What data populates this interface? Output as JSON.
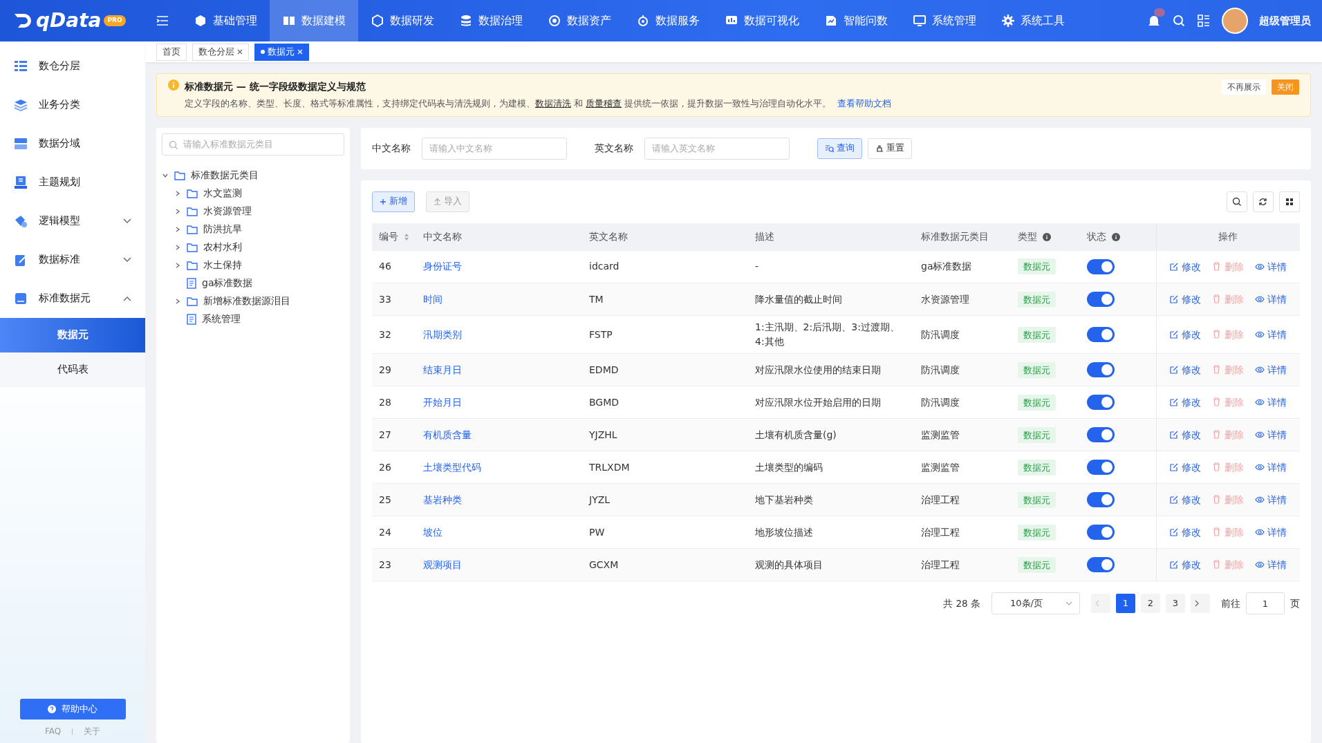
{
  "topbar": {
    "logo": "qData",
    "logo_badge": "PRO",
    "nav": [
      {
        "label": "基础管理",
        "selected": false
      },
      {
        "label": "数据建模",
        "selected": true
      },
      {
        "label": "数据研发",
        "selected": false
      },
      {
        "label": "数据治理",
        "selected": false
      },
      {
        "label": "数据资产",
        "selected": false
      },
      {
        "label": "数据服务",
        "selected": false
      },
      {
        "label": "数据可视化",
        "selected": false
      },
      {
        "label": "智能问数",
        "selected": false
      },
      {
        "label": "系统管理",
        "selected": false
      },
      {
        "label": "系统工具",
        "selected": false
      }
    ],
    "user": "超级管理员"
  },
  "sidebar": {
    "items": [
      {
        "label": "数仓分层"
      },
      {
        "label": "业务分类"
      },
      {
        "label": "数据分域"
      },
      {
        "label": "主题规划"
      },
      {
        "label": "逻辑模型",
        "expanded": false
      },
      {
        "label": "数据标准",
        "expanded": false
      },
      {
        "label": "标准数据元",
        "expanded": true,
        "children": [
          {
            "label": "数据元",
            "selected": true
          },
          {
            "label": "代码表",
            "selected": false
          }
        ]
      }
    ],
    "help_button": "帮助中心",
    "footer_links": [
      "FAQ",
      "关于"
    ]
  },
  "tabs": [
    {
      "label": "首页",
      "selected": false,
      "closable": false
    },
    {
      "label": "数仓分层",
      "selected": false,
      "closable": true
    },
    {
      "label": "数据元",
      "selected": true,
      "closable": true
    }
  ],
  "notice": {
    "title": "标准数据元 — 统一字段级数据定义与规范",
    "segments": [
      {
        "kind": "text",
        "text": "定义字段的名称、类型、长度、格式等标准属性，支持绑定代码表与清洗规则，为建模、"
      },
      {
        "kind": "underline",
        "text": "数据清洗"
      },
      {
        "kind": "text",
        "text": " 和 "
      },
      {
        "kind": "underline",
        "text": "质量稽查"
      },
      {
        "kind": "text",
        "text": " 提供统一依据，提升数据一致性与治理自动化水平。 "
      },
      {
        "kind": "link",
        "text": "查看帮助文档"
      }
    ],
    "buttons": [
      "不再展示",
      "关闭"
    ]
  },
  "tree": {
    "search_placeholder": "请输入标准数据元类目",
    "nodes": [
      {
        "label": "标准数据元类目",
        "kind": "folder",
        "expanded": true,
        "children": [
          {
            "label": "水文监测",
            "kind": "folder",
            "expanded": false
          },
          {
            "label": "水资源管理",
            "kind": "folder",
            "expanded": false
          },
          {
            "label": "防洪抗旱",
            "kind": "folder",
            "expanded": false
          },
          {
            "label": "农村水利",
            "kind": "folder",
            "expanded": false
          },
          {
            "label": "水土保持",
            "kind": "folder",
            "expanded": false
          },
          {
            "label": "ga标准数据",
            "kind": "file"
          },
          {
            "label": "新增标准数据源泪目",
            "kind": "folder",
            "expanded": false
          },
          {
            "label": "系统管理",
            "kind": "file"
          }
        ]
      }
    ]
  },
  "filters": [
    {
      "label": "中文名称",
      "placeholder": "请输入中文名称"
    },
    {
      "label": "英文名称",
      "placeholder": "请输入英文名称"
    }
  ],
  "filter_buttons": [
    {
      "label": "查询",
      "kind": "primary"
    },
    {
      "label": "重置",
      "kind": "plain"
    }
  ],
  "toolbar": [
    {
      "label": "新增",
      "kind": "primary",
      "disabled": false
    },
    {
      "label": "导入",
      "kind": "plain",
      "disabled": true
    }
  ],
  "table": {
    "columns": [
      {
        "label": "编号",
        "sortable": true
      },
      {
        "label": "中文名称"
      },
      {
        "label": "英文名称"
      },
      {
        "label": "描述"
      },
      {
        "label": "标准数据元类目"
      },
      {
        "label": "类型",
        "info": true
      },
      {
        "label": "状态",
        "info": true
      },
      {
        "label": "操作"
      }
    ],
    "rows": [
      {
        "id": "46",
        "name": "身份证号",
        "code": "idcard",
        "desc": "-",
        "category": "ga标准数据",
        "type": "数据元",
        "on": true,
        "actions": [
          "修改",
          "删除",
          "详情"
        ]
      },
      {
        "id": "33",
        "name": "时间",
        "code": "TM",
        "desc": "降水量值的截止时间",
        "category": "水资源管理",
        "type": "数据元",
        "on": true,
        "actions": [
          "修改",
          "删除",
          "详情"
        ]
      },
      {
        "id": "32",
        "name": "汛期类别",
        "code": "FSTP",
        "desc": "1:主汛期、2:后汛期、3:过渡期、4:其他",
        "category": "防汛调度",
        "type": "数据元",
        "on": true,
        "actions": [
          "修改",
          "删除",
          "详情"
        ]
      },
      {
        "id": "29",
        "name": "结束月日",
        "code": "EDMD",
        "desc": "对应汛限水位使用的结束日期",
        "category": "防汛调度",
        "type": "数据元",
        "on": true,
        "actions": [
          "修改",
          "删除",
          "详情"
        ]
      },
      {
        "id": "28",
        "name": "开始月日",
        "code": "BGMD",
        "desc": "对应汛限水位开始启用的日期",
        "category": "防汛调度",
        "type": "数据元",
        "on": true,
        "actions": [
          "修改",
          "删除",
          "详情"
        ]
      },
      {
        "id": "27",
        "name": "有机质含量",
        "code": "YJZHL",
        "desc": "土壤有机质含量(g)",
        "category": "监测监管",
        "type": "数据元",
        "on": true,
        "actions": [
          "修改",
          "删除",
          "详情"
        ]
      },
      {
        "id": "26",
        "name": "土壤类型代码",
        "code": "TRLXDM",
        "desc": "土壤类型的编码",
        "category": "监测监管",
        "type": "数据元",
        "on": true,
        "actions": [
          "修改",
          "删除",
          "详情"
        ]
      },
      {
        "id": "25",
        "name": "基岩种类",
        "code": "JYZL",
        "desc": "地下基岩种类",
        "category": "治理工程",
        "type": "数据元",
        "on": true,
        "actions": [
          "修改",
          "删除",
          "详情"
        ]
      },
      {
        "id": "24",
        "name": "坡位",
        "code": "PW",
        "desc": "地形坡位描述",
        "category": "治理工程",
        "type": "数据元",
        "on": true,
        "actions": [
          "修改",
          "删除",
          "详情"
        ]
      },
      {
        "id": "23",
        "name": "观测项目",
        "code": "GCXM",
        "desc": "观测的具体项目",
        "category": "治理工程",
        "type": "数据元",
        "on": true,
        "actions": [
          "修改",
          "删除",
          "详情"
        ]
      }
    ]
  },
  "pagination": {
    "total": "共 28 条",
    "page_size": "10条/页",
    "pages": [
      {
        "label": "1",
        "selected": true
      },
      {
        "label": "2",
        "selected": false
      },
      {
        "label": "3",
        "selected": false
      }
    ],
    "goto_label": "前往",
    "goto_value": "1",
    "goto_suffix": "页"
  }
}
